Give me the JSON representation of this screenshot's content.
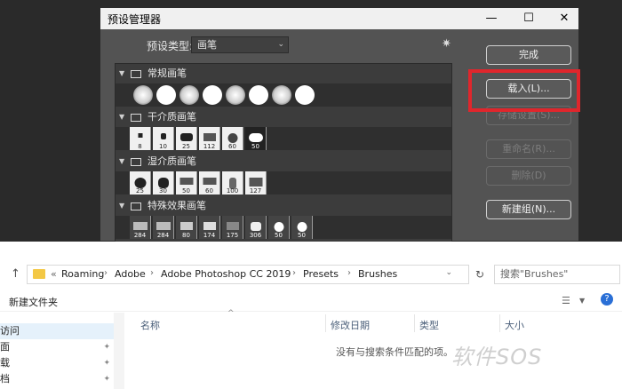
{
  "dialog": {
    "title": "预设管理器",
    "minimize": "—",
    "maximize": "☐",
    "close": "✕",
    "preset_type_label": "预设类型:",
    "preset_type_value": "画笔",
    "groups": [
      {
        "name": "常规画笔",
        "counts": [
          "",
          "",
          "",
          "",
          "",
          "",
          "",
          ""
        ]
      },
      {
        "name": "干介质画笔",
        "counts": [
          "8",
          "10",
          "25",
          "112",
          "60",
          "50"
        ]
      },
      {
        "name": "湿介质画笔",
        "counts": [
          "25",
          "30",
          "50",
          "60",
          "100",
          "127"
        ]
      },
      {
        "name": "特殊效果画笔",
        "counts": [
          "284",
          "284",
          "80",
          "174",
          "175",
          "306",
          "50",
          "50"
        ]
      }
    ],
    "buttons": {
      "done": "完成",
      "load": "载入(L)...",
      "save": "存储设置(S)...",
      "rename": "重命名(R)...",
      "delete": "删除(D)",
      "new_group": "新建组(N)..."
    }
  },
  "explorer": {
    "breadcrumb": [
      "Roaming",
      "Adobe",
      "Adobe Photoshop CC 2019",
      "Presets",
      "Brushes"
    ],
    "breadcrumb_prefix": "«",
    "search_placeholder": "搜索\"Brushes\"",
    "new_folder": "新建文件夹",
    "nav_items": [
      "访问",
      "面",
      "载",
      "档"
    ],
    "columns": [
      "名称",
      "修改日期",
      "类型",
      "大小"
    ],
    "empty_message": "没有与搜索条件匹配的项。"
  },
  "watermark": "软件SOS",
  "colors": {
    "highlight": "#e0262c",
    "dialog_bg": "#535353"
  }
}
